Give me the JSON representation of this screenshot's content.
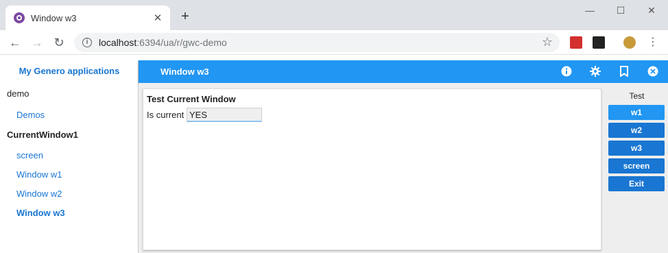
{
  "browser": {
    "tab_title": "Window w3",
    "url_host": "localhost",
    "url_path": ":6394/ua/r/gwc-demo"
  },
  "sidebar": {
    "title": "My Genero applications",
    "groups": [
      {
        "label": "demo",
        "items": [
          "Demos"
        ]
      },
      {
        "label": "CurrentWindow1",
        "items": [
          "screen",
          "Window w1",
          "Window w2",
          "Window w3"
        ]
      }
    ],
    "active_item": "Window w3"
  },
  "appbar": {
    "title": "Window w3"
  },
  "form": {
    "title": "Test Current Window",
    "field_label": "Is current",
    "field_value": "YES"
  },
  "actions": {
    "title": "Test",
    "buttons": [
      "w1",
      "w2",
      "w3",
      "screen",
      "Exit"
    ]
  },
  "colors": {
    "accent": "#2196f3",
    "button": "#1976d2",
    "link": "#1976d2"
  }
}
